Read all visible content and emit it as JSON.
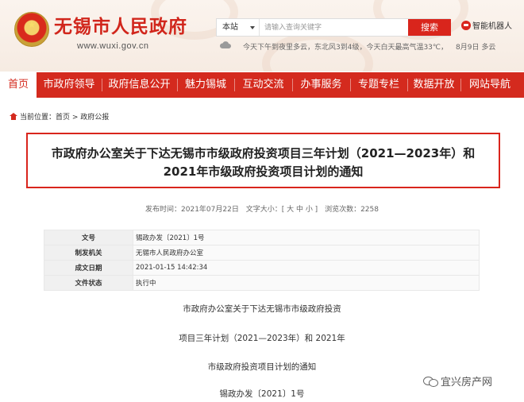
{
  "header": {
    "site_title": "无锡市人民政府",
    "site_url": "www.wuxi.gov.cn",
    "search": {
      "scope": "本站",
      "placeholder": "请输入查询关键字",
      "button_label": "搜索"
    },
    "robot_label": "智能机器人",
    "weather_text": "今天下午到夜里多云，东北风3到4级，今天白天最高气温33℃，",
    "date_text": "8月9日  多云"
  },
  "nav": {
    "items": [
      "首页",
      "市政府领导",
      "政府信息公开",
      "魅力锡城",
      "互动交流",
      "办事服务",
      "专题专栏",
      "数据开放",
      "网站导航"
    ],
    "active": "首页"
  },
  "breadcrumb": {
    "label": "当前位置：",
    "home": "首页",
    "sep": " > ",
    "current": "政府公报"
  },
  "article": {
    "title_line1": "市政府办公室关于下达无锡市市级政府投资项目三年计划（2021—2023年）和",
    "title_line2": "2021年市级政府投资项目计划的通知",
    "meta": {
      "published": "发布时间：2021年07月22日",
      "font_size": "文字大小：[ 大 中 小 ]",
      "views": "浏览次数：2258"
    },
    "info_rows": [
      {
        "label": "文号",
        "value": "锡政办发〔2021〕1号"
      },
      {
        "label": "制发机关",
        "value": "无锡市人民政府办公室"
      },
      {
        "label": "成文日期",
        "value": "2021-01-15 14:42:34"
      },
      {
        "label": "文件状态",
        "value": "执行中"
      }
    ],
    "body_lines": [
      "市政府办公室关于下达无锡市市级政府投资",
      "项目三年计划（2021—2023年）和 2021年",
      "市级政府投资项目计划的通知",
      "锡政办发〔2021〕1号"
    ]
  },
  "watermark": "宜兴房产网",
  "colors": {
    "brand_red": "#d42a1e",
    "header_bg": "#f6ebe2"
  }
}
